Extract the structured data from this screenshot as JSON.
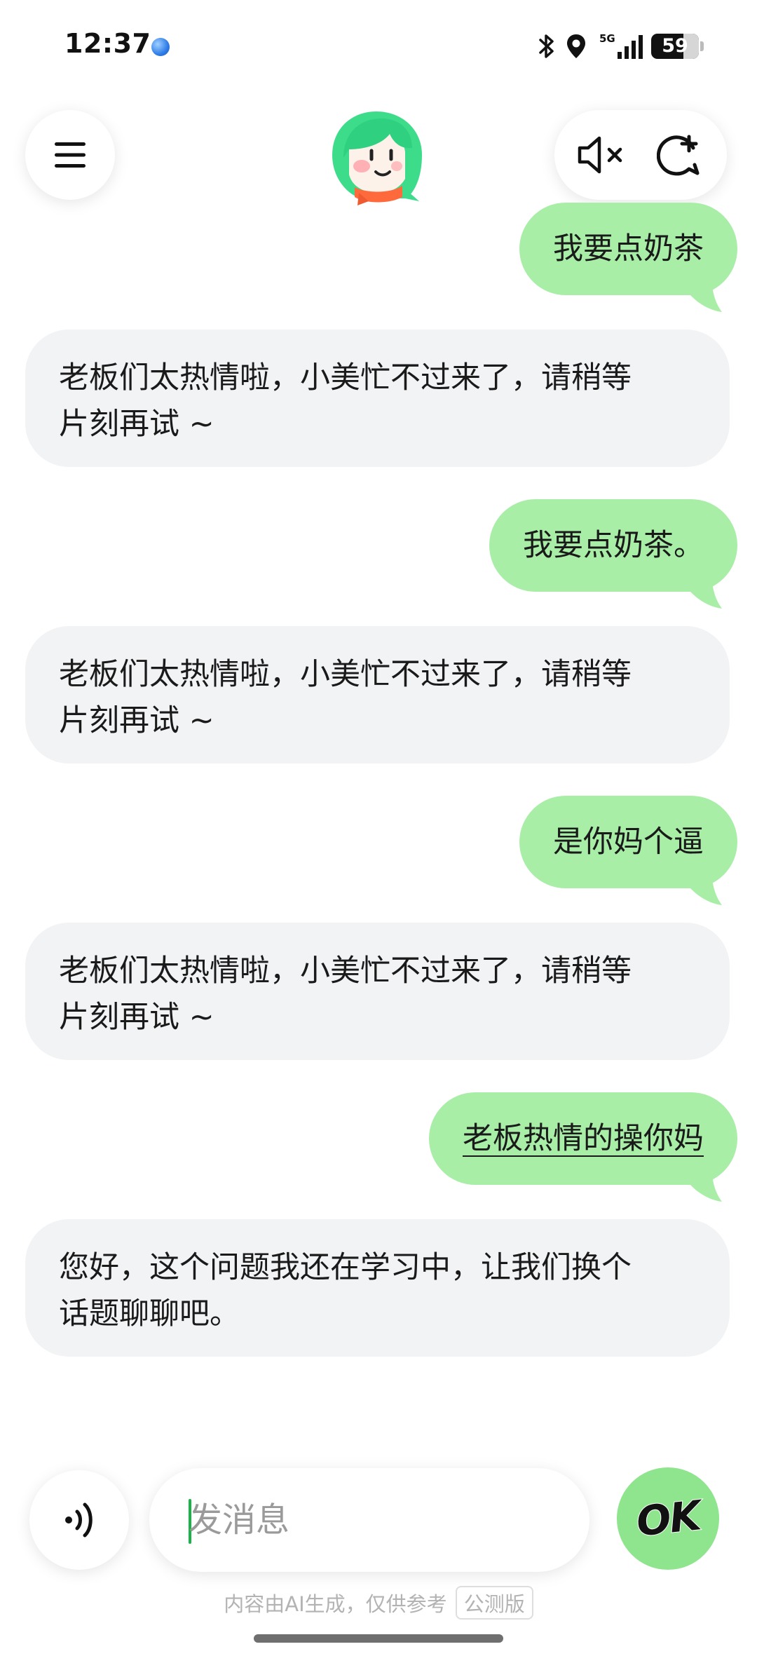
{
  "status_bar": {
    "time": "12:37",
    "network": "5G",
    "battery": "59"
  },
  "header": {
    "menu_icon": "hamburger-menu-icon",
    "mute_icon": "speaker-muted-icon",
    "new_chat_icon": "new-chat-plus-icon",
    "avatar": "assistant-avatar-green-hair-girl"
  },
  "messages": [
    {
      "role": "user",
      "text": "我要点奶茶"
    },
    {
      "role": "assistant",
      "lines": [
        "老板们太热情啦，小美忙不过来了，请稍等",
        "片刻再试 ~"
      ]
    },
    {
      "role": "user",
      "text": "我要点奶茶。"
    },
    {
      "role": "assistant",
      "lines": [
        "老板们太热情啦，小美忙不过来了，请稍等",
        "片刻再试 ~"
      ]
    },
    {
      "role": "user",
      "text": "是你妈个逼"
    },
    {
      "role": "assistant",
      "lines": [
        "老板们太热情啦，小美忙不过来了，请稍等",
        "片刻再试 ~"
      ]
    },
    {
      "role": "user",
      "text": "老板热情的操你妈"
    },
    {
      "role": "assistant",
      "lines": [
        "您好，这个问题我还在学习中，让我们换个",
        "话题聊聊吧。"
      ]
    }
  ],
  "composer": {
    "placeholder": "发消息",
    "voice_icon": "voice-wave-icon",
    "send_label": "OK"
  },
  "footer": {
    "disclaimer": "内容由AI生成，仅供参考",
    "badge": "公测版"
  },
  "colors": {
    "user_bubble": "#a8eea7",
    "assistant_bubble": "#f2f3f5",
    "send_button": "#8ee58d"
  }
}
